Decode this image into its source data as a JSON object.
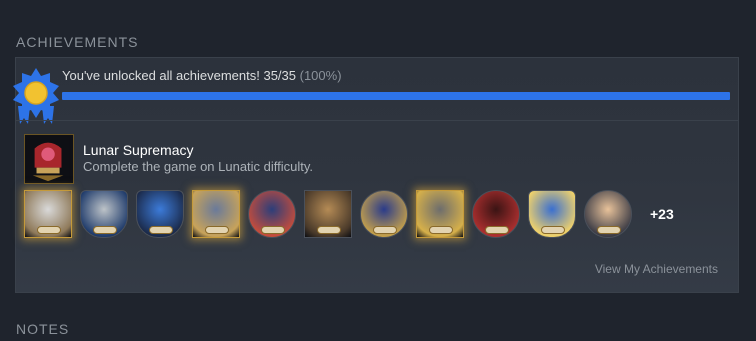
{
  "sections": {
    "achievements_title": "ACHIEVEMENTS",
    "notes_title": "NOTES"
  },
  "summary": {
    "text": "You've unlocked all achievements! 35/35",
    "percent_text": "(100%)",
    "progress_fraction": 1.0,
    "icon": "medal-icon"
  },
  "featured": {
    "name": "Lunar Supremacy",
    "description": "Complete the game on Lunatic difficulty.",
    "icon": "lunar-supremacy-icon"
  },
  "achievement_icons": [
    {
      "name": "achievement-icon-knight",
      "frame": "gold",
      "shape": "square",
      "colors": [
        "#d9d9d9",
        "#8f7a5a"
      ]
    },
    {
      "name": "achievement-icon-gears",
      "frame": "plain",
      "shape": "shield",
      "colors": [
        "#bdc3c8",
        "#1f3b6b"
      ]
    },
    {
      "name": "achievement-icon-blue-book",
      "frame": "plain",
      "shape": "shield",
      "colors": [
        "#3c7bd9",
        "#1b2a4a"
      ]
    },
    {
      "name": "achievement-icon-mech-card",
      "frame": "gold",
      "shape": "square",
      "colors": [
        "#6a7a9a",
        "#c8a35a"
      ]
    },
    {
      "name": "achievement-icon-clock-tower",
      "frame": "plain",
      "shape": "round",
      "colors": [
        "#2c3e7a",
        "#c94d3a"
      ]
    },
    {
      "name": "achievement-icon-chest",
      "frame": "plain",
      "shape": "square",
      "colors": [
        "#b58b55",
        "#4a3a2a"
      ]
    },
    {
      "name": "achievement-icon-throne",
      "frame": "plain",
      "shape": "round",
      "colors": [
        "#2a3b8a",
        "#c7a24a"
      ]
    },
    {
      "name": "achievement-icon-fortress",
      "frame": "gold",
      "shape": "square",
      "colors": [
        "#6d6d6d",
        "#d6b04a"
      ]
    },
    {
      "name": "achievement-icon-dark-figures",
      "frame": "plain",
      "shape": "round",
      "colors": [
        "#3a1414",
        "#b03030"
      ]
    },
    {
      "name": "achievement-icon-lightning",
      "frame": "plain",
      "shape": "shield",
      "colors": [
        "#3a6fd0",
        "#f2d36a"
      ]
    },
    {
      "name": "achievement-icon-portrait",
      "frame": "plain",
      "shape": "round",
      "colors": [
        "#e8c29a",
        "#3a3a44"
      ]
    }
  ],
  "more_count": "+23",
  "view_link": "View My Achievements",
  "colors": {
    "accent_blue": "#2d73e8",
    "gold": "#e8b03a",
    "background": "#1f242d"
  }
}
